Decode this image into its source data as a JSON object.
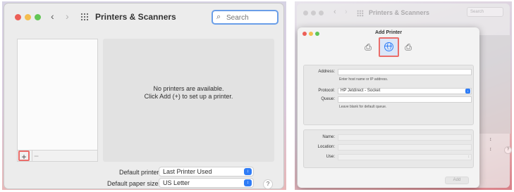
{
  "left": {
    "window_title": "Printers & Scanners",
    "nav_back": "‹",
    "nav_forward": "›",
    "search": {
      "placeholder": "Search",
      "icon": "magnifier-icon"
    },
    "list_controls": {
      "add": "+",
      "remove": "−"
    },
    "empty_state": {
      "line1": "No printers are available.",
      "line2": "Click Add (+) to set up a printer."
    },
    "default_printer": {
      "label": "Default printer:",
      "value": "Last Printer Used"
    },
    "default_paper": {
      "label": "Default paper size:",
      "value": "US Letter"
    },
    "help": "?"
  },
  "right": {
    "background_window_title": "Printers & Scanners",
    "background_search_placeholder": "Search",
    "sheet": {
      "title": "Add Printer",
      "toolbar": [
        {
          "name": "default-printer-icon",
          "glyph": "⎙"
        },
        {
          "name": "ip-globe-icon",
          "selected": true
        },
        {
          "name": "windows-printer-icon",
          "glyph": "⎙"
        }
      ],
      "address": {
        "label": "Address:",
        "value": "",
        "hint": "Enter host name or IP address."
      },
      "protocol": {
        "label": "Protocol:",
        "value": "HP Jetdirect - Socket"
      },
      "queue": {
        "label": "Queue:",
        "value": "",
        "hint": "Leave blank for default queue."
      },
      "name": {
        "label": "Name:",
        "value": ""
      },
      "location": {
        "label": "Location:",
        "value": ""
      },
      "use": {
        "label": "Use:",
        "value": ""
      },
      "add_button": "Add"
    },
    "help": "?"
  },
  "colors": {
    "highlight": "#ea6d6a",
    "accent_blue": "#2f7cf6",
    "traffic_red": "#ec5f57",
    "traffic_yellow": "#f4bd4f",
    "traffic_green": "#62c655"
  }
}
